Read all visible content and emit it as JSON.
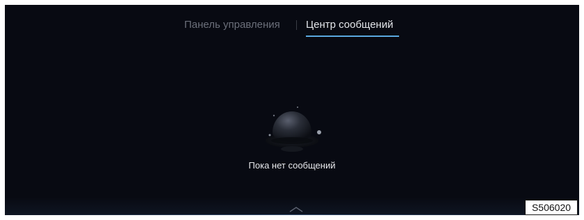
{
  "tabs": {
    "dashboard_label": "Панель управления",
    "messages_label": "Центр сообщений",
    "active": "messages"
  },
  "empty_state": {
    "message": "Пока нет сообщений",
    "icon": "planet-icon"
  },
  "bottom_handle": {
    "icon": "chevron-up-icon"
  },
  "figure_code": "S506020",
  "colors": {
    "background": "#080a12",
    "active_tab": "#e4e6ea",
    "inactive_tab": "#6b6f7a",
    "accent_underline": "#5aa9e0"
  }
}
